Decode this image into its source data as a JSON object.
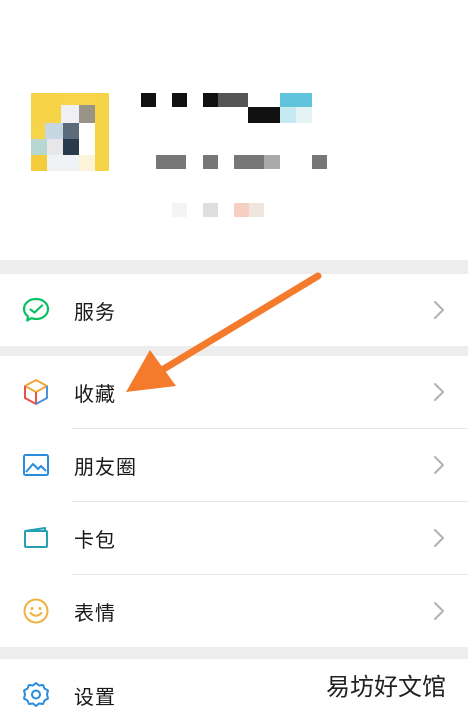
{
  "menu": {
    "services": {
      "label": "服务",
      "icon": "wechat-pay-icon"
    },
    "favorites": {
      "label": "收藏",
      "icon": "cube-icon"
    },
    "moments": {
      "label": "朋友圈",
      "icon": "picture-icon"
    },
    "cards": {
      "label": "卡包",
      "icon": "card-wallet-icon"
    },
    "stickers": {
      "label": "表情",
      "icon": "smiley-icon"
    },
    "settings": {
      "label": "设置",
      "icon": "gear-icon"
    }
  },
  "annotation": {
    "arrow_color": "#f47a2c"
  },
  "watermark": {
    "text": "易坊好文馆"
  },
  "colors": {
    "accent_green": "#07c160",
    "section_gap": "#ededed"
  }
}
